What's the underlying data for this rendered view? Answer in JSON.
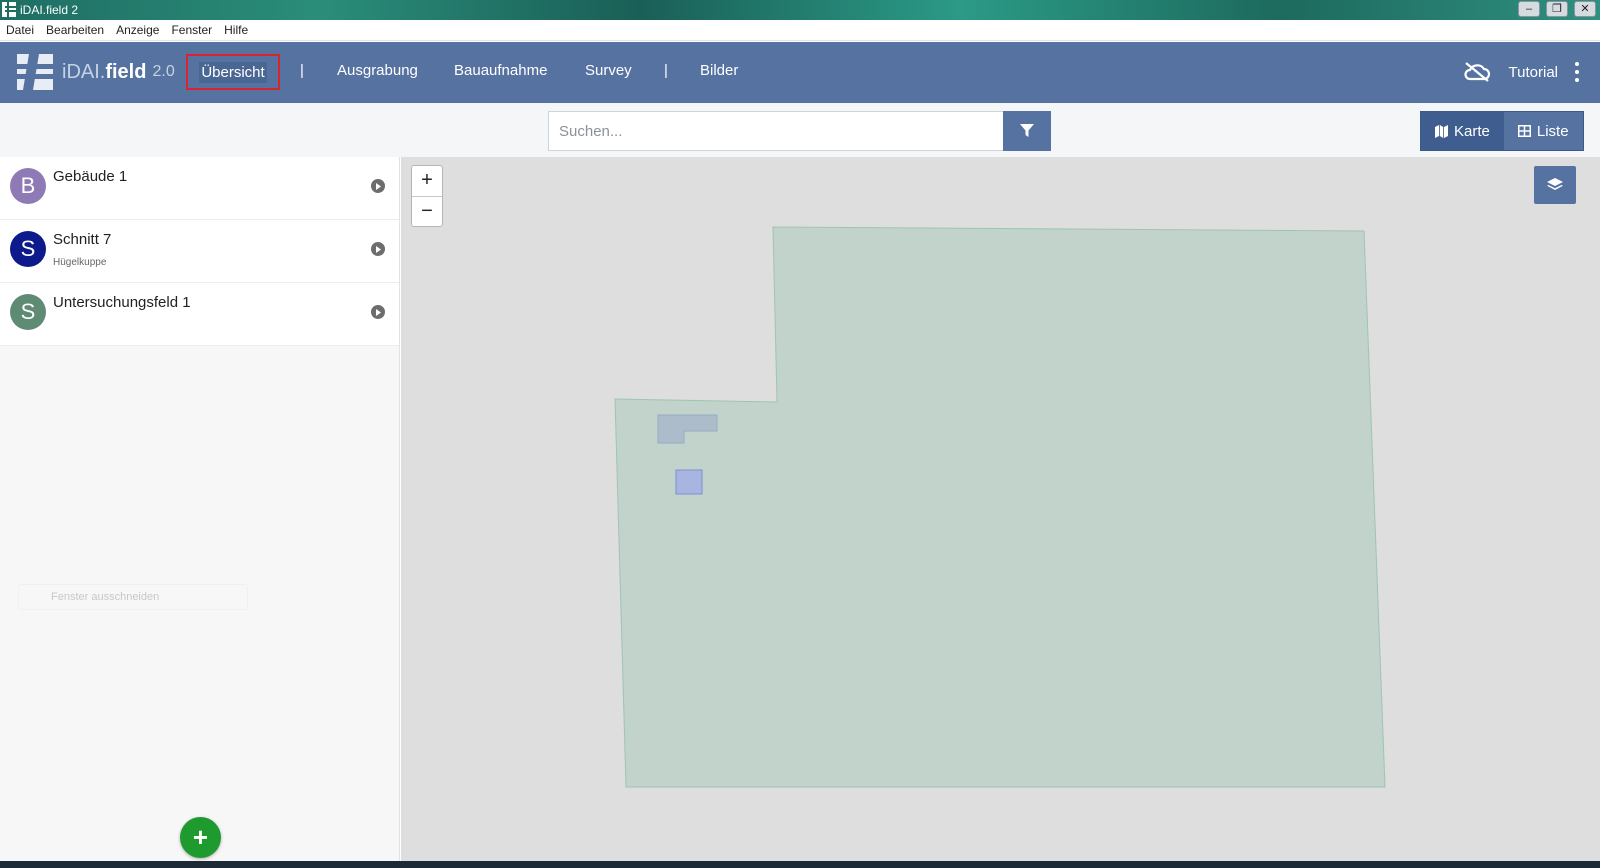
{
  "window": {
    "title": "iDAI.field 2",
    "controls": [
      "–",
      "❐",
      "✕"
    ]
  },
  "menubar": {
    "items": [
      "Datei",
      "Bearbeiten",
      "Anzeige",
      "Fenster",
      "Hilfe"
    ]
  },
  "navbar": {
    "brand_prefix": "iDAI.",
    "brand_main": "field",
    "brand_version": "2.0",
    "active_tab": "Übersicht",
    "separator": "|",
    "tabs": [
      "Ausgrabung",
      "Bauaufnahme",
      "Survey"
    ],
    "images_tab": "Bilder",
    "tutorial": "Tutorial"
  },
  "search": {
    "placeholder": "Suchen..."
  },
  "view_toggle": {
    "map": "Karte",
    "list": "Liste",
    "active": "Karte"
  },
  "sidebar": {
    "items": [
      {
        "letter": "B",
        "title": "Gebäude 1",
        "subtitle": "",
        "color": "#8e7ab5"
      },
      {
        "letter": "S",
        "title": "Schnitt 7",
        "subtitle": "Hügelkuppe",
        "color": "#0d1a8c"
      },
      {
        "letter": "S",
        "title": "Untersuchungsfeld 1",
        "subtitle": "",
        "color": "#5f8a73"
      }
    ],
    "ghost_label": "Fenster ausschneiden",
    "add_button": "+"
  },
  "map": {
    "zoom_in": "+",
    "zoom_out": "−"
  },
  "colors": {
    "navbar": "#5572a1",
    "highlight_border": "#d9232d",
    "add_button": "#1e9a2f",
    "map_background": "#dedede",
    "survey_area_fill": "#c2d3cc",
    "building_fill": "#a9b7c9",
    "trench_fill": "#a7b5e0"
  }
}
